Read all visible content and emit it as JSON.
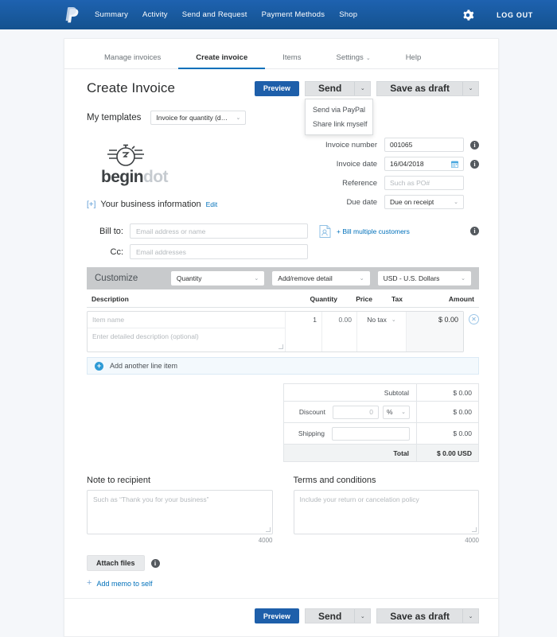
{
  "nav": {
    "logo_icon": "paypal-logo-icon",
    "links": [
      {
        "label": "Summary"
      },
      {
        "label": "Activity"
      },
      {
        "label": "Send and Request"
      },
      {
        "label": "Payment Methods"
      },
      {
        "label": "Shop"
      }
    ],
    "gear_icon": "gear-icon",
    "logout_label": "LOG OUT",
    "bg_color": "#1a5ca8"
  },
  "tabs": [
    {
      "label": "Manage invoices",
      "active": false,
      "caret": ""
    },
    {
      "label": "Create invoice",
      "active": true,
      "caret": ""
    },
    {
      "label": "Items",
      "active": false,
      "caret": ""
    },
    {
      "label": "Settings",
      "active": false,
      "caret": "⌄"
    },
    {
      "label": "Help",
      "active": false,
      "caret": ""
    }
  ],
  "header": {
    "title": "Create Invoice",
    "preview_label": "Preview",
    "send_label": "Send",
    "save_draft_label": "Save as draft",
    "caret": "⌄",
    "send_menu": [
      {
        "label": "Send via PayPal"
      },
      {
        "label": "Share link myself"
      }
    ]
  },
  "templates": {
    "label": "My templates",
    "selected": "Invoice for quantity (default)"
  },
  "business": {
    "logo_text_1": "begin",
    "logo_text_2": "dot",
    "logo_icon": "stopwatch-icon",
    "expand_icon": "[+]",
    "info_label": "Your business information",
    "edit_label": "Edit"
  },
  "invoice_meta": [
    {
      "label": "Invoice number",
      "value": "001065",
      "placeholder": "",
      "type": "text",
      "info": true,
      "icon": ""
    },
    {
      "label": "Invoice date",
      "value": "16/04/2018",
      "placeholder": "",
      "type": "date",
      "info": true,
      "icon": "calendar-icon"
    },
    {
      "label": "Reference",
      "value": "",
      "placeholder": "Such as PO#",
      "type": "text",
      "info": false,
      "icon": ""
    },
    {
      "label": "Due date",
      "value": "Due on receipt",
      "placeholder": "",
      "type": "select",
      "info": false,
      "icon": "chevron-down-icon"
    }
  ],
  "bill_to": {
    "label": "Bill to:",
    "placeholder": "Email address or name",
    "value": "",
    "cc_label": "Cc:",
    "cc_placeholder": "Email addresses",
    "cc_value": "",
    "multi_icon": "bill-multiple-customers-icon",
    "multi_label": "+ Bill multiple customers"
  },
  "customize": {
    "label": "Customize",
    "quantity_option": "Quantity",
    "detail_option": "Add/remove detail",
    "currency_option": "USD - U.S. Dollars",
    "caret": "⌄"
  },
  "items_table": {
    "columns": [
      "Description",
      "Quantity",
      "Price",
      "Tax",
      "Amount"
    ],
    "rows": [
      {
        "name_placeholder": "Item name",
        "desc_placeholder": "Enter detailed description (optional)",
        "quantity": "1",
        "price": "0.00",
        "tax": "No tax",
        "amount": "$ 0.00",
        "delete_icon": "delete-line-item-icon"
      }
    ],
    "add_line_label": "Add another line item",
    "add_icon": "plus-circle-icon"
  },
  "totals": {
    "subtotal_label": "Subtotal",
    "subtotal_value": "$ 0.00",
    "discount_label": "Discount",
    "discount_value": "0",
    "discount_unit": "%",
    "discount_amount": "$ 0.00",
    "shipping_label": "Shipping",
    "shipping_value": "",
    "shipping_amount": "$ 0.00",
    "total_label": "Total",
    "total_value": "$ 0.00 USD",
    "caret": "⌄"
  },
  "notes": {
    "note_title": "Note to recipient",
    "note_placeholder": "Such as “Thank you for your business”",
    "note_value": "",
    "note_counter": "4000",
    "terms_title": "Terms and conditions",
    "terms_placeholder": "Include your return or cancelation policy",
    "terms_value": "",
    "terms_counter": "4000"
  },
  "attachments": {
    "attach_label": "Attach files",
    "memo_label": "Add memo to self",
    "memo_plus": "+"
  },
  "footer": {
    "preview_label": "Preview",
    "send_label": "Send",
    "save_draft_label": "Save as draft",
    "caret": "⌄"
  },
  "colors": {
    "paypal_blue": "#1a5ca8",
    "primary_button": "#1e5faa",
    "link_blue": "#0070ba",
    "customize_bar": "#c8cacc",
    "page_bg": "#f5f7fa"
  }
}
